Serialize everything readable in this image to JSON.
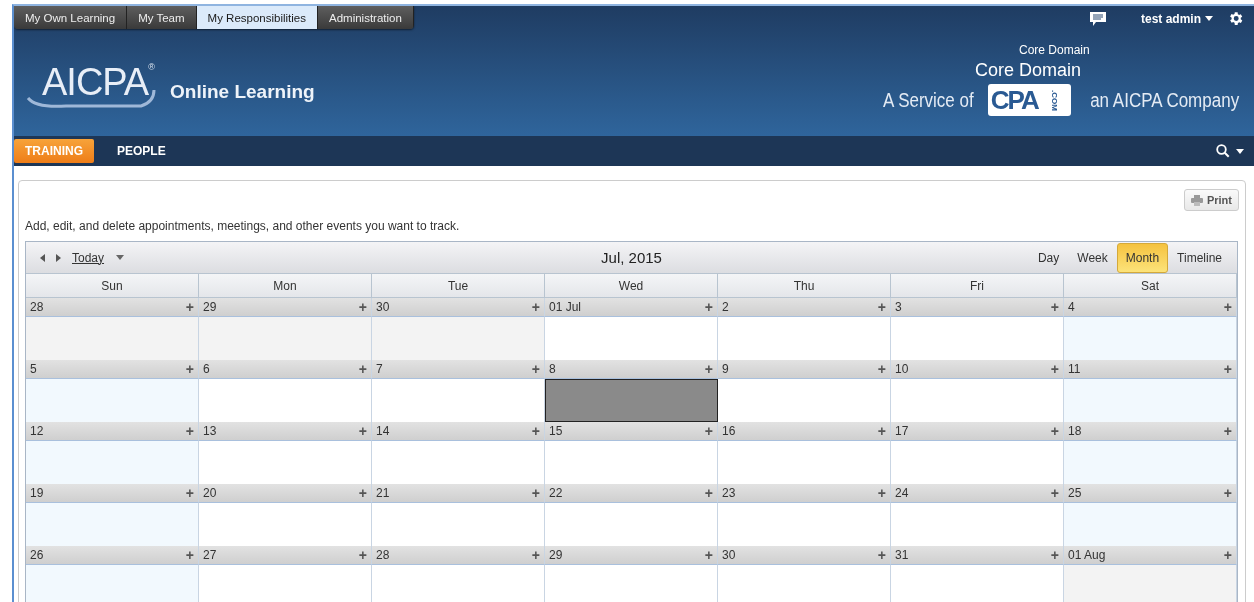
{
  "top_tabs": [
    {
      "label": "My Own Learning",
      "selected": false
    },
    {
      "label": "My Team",
      "selected": false
    },
    {
      "label": "My Responsibilities",
      "selected": true
    },
    {
      "label": "Administration",
      "selected": false
    }
  ],
  "user": {
    "name": "test admin"
  },
  "brand": {
    "logo": "AICPA",
    "registered": "®",
    "product": "Online Learning"
  },
  "domain": {
    "small_label": "Core Domain",
    "large_label": "Core Domain"
  },
  "partner": {
    "prefix": "A Service of",
    "logo": "CPA",
    "logo_suffix": ".COM",
    "suffix": "an AICPA Company"
  },
  "nav": [
    {
      "label": "TRAINING",
      "selected": true
    },
    {
      "label": "PEOPLE",
      "selected": false
    }
  ],
  "print_button": "Print",
  "description": "Add, edit, and delete appointments, meetings, and other events you want to track.",
  "calendar": {
    "today_link": "Today",
    "period": "Jul, 2015",
    "views": [
      {
        "label": "Day",
        "selected": false
      },
      {
        "label": "Week",
        "selected": false
      },
      {
        "label": "Month",
        "selected": true
      },
      {
        "label": "Timeline",
        "selected": false
      }
    ],
    "weekdays": [
      "Sun",
      "Mon",
      "Tue",
      "Wed",
      "Thu",
      "Fri",
      "Sat"
    ],
    "add_glyph": "+",
    "weeks": [
      [
        {
          "date": "28",
          "kind": "other",
          "selected": false
        },
        {
          "date": "29",
          "kind": "other",
          "selected": false
        },
        {
          "date": "30",
          "kind": "other",
          "selected": false
        },
        {
          "date": "01 Jul",
          "kind": "normal",
          "selected": false
        },
        {
          "date": "2",
          "kind": "normal",
          "selected": false
        },
        {
          "date": "3",
          "kind": "normal",
          "selected": false
        },
        {
          "date": "4",
          "kind": "weekend",
          "selected": false
        }
      ],
      [
        {
          "date": "5",
          "kind": "weekend",
          "selected": false
        },
        {
          "date": "6",
          "kind": "normal",
          "selected": false
        },
        {
          "date": "7",
          "kind": "normal",
          "selected": false
        },
        {
          "date": "8",
          "kind": "normal",
          "selected": true
        },
        {
          "date": "9",
          "kind": "normal",
          "selected": false
        },
        {
          "date": "10",
          "kind": "normal",
          "selected": false
        },
        {
          "date": "11",
          "kind": "weekend",
          "selected": false
        }
      ],
      [
        {
          "date": "12",
          "kind": "weekend",
          "selected": false
        },
        {
          "date": "13",
          "kind": "normal",
          "selected": false
        },
        {
          "date": "14",
          "kind": "normal",
          "selected": false
        },
        {
          "date": "15",
          "kind": "normal",
          "selected": false
        },
        {
          "date": "16",
          "kind": "normal",
          "selected": false
        },
        {
          "date": "17",
          "kind": "normal",
          "selected": false
        },
        {
          "date": "18",
          "kind": "weekend",
          "selected": false
        }
      ],
      [
        {
          "date": "19",
          "kind": "weekend",
          "selected": false
        },
        {
          "date": "20",
          "kind": "normal",
          "selected": false
        },
        {
          "date": "21",
          "kind": "normal",
          "selected": false
        },
        {
          "date": "22",
          "kind": "normal",
          "selected": false
        },
        {
          "date": "23",
          "kind": "normal",
          "selected": false
        },
        {
          "date": "24",
          "kind": "normal",
          "selected": false
        },
        {
          "date": "25",
          "kind": "weekend",
          "selected": false
        }
      ],
      [
        {
          "date": "26",
          "kind": "weekend",
          "selected": false
        },
        {
          "date": "27",
          "kind": "normal",
          "selected": false
        },
        {
          "date": "28",
          "kind": "normal",
          "selected": false
        },
        {
          "date": "29",
          "kind": "normal",
          "selected": false
        },
        {
          "date": "30",
          "kind": "normal",
          "selected": false
        },
        {
          "date": "31",
          "kind": "normal",
          "selected": false
        },
        {
          "date": "01 Aug",
          "kind": "other",
          "selected": false
        }
      ]
    ]
  }
}
